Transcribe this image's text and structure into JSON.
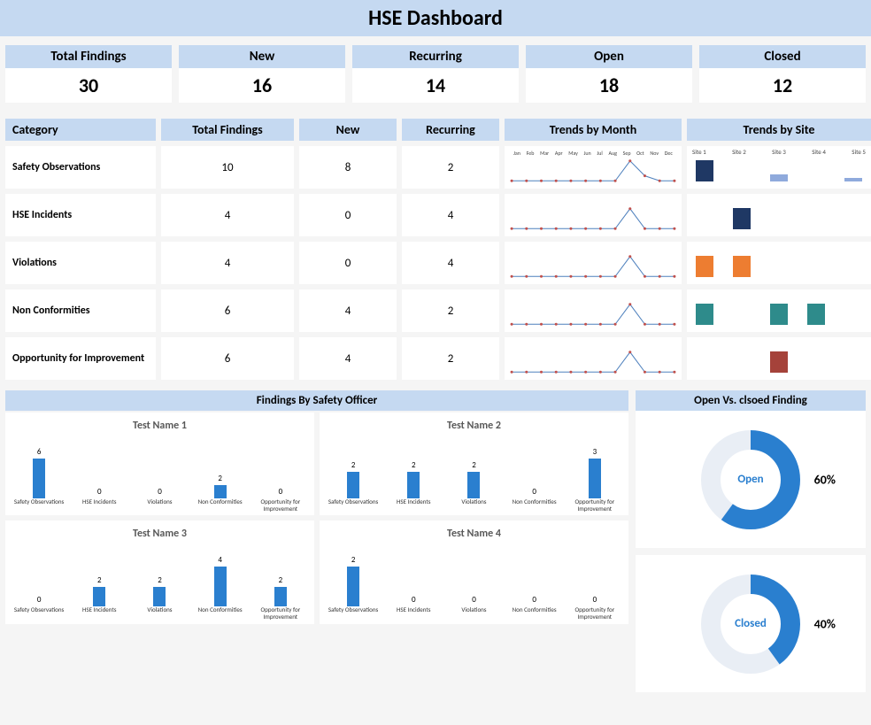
{
  "title": "HSE Dashboard",
  "kpis": [
    {
      "label": "Total Findings",
      "value": "30"
    },
    {
      "label": "New",
      "value": "16"
    },
    {
      "label": "Recurring",
      "value": "14"
    },
    {
      "label": "Open",
      "value": "18"
    },
    {
      "label": "Closed",
      "value": "12"
    }
  ],
  "cat_headers": {
    "category": "Category",
    "total": "Total Findings",
    "new": "New",
    "recurring": "Recurring",
    "trends_month": "Trends by Month",
    "trends_site": "Trends by Site"
  },
  "months": [
    "Jan",
    "Feb",
    "Mar",
    "Apr",
    "May",
    "Jun",
    "Jul",
    "Aug",
    "Sep",
    "Oct",
    "Nov",
    "Dec"
  ],
  "sites": [
    "Site 1",
    "Site 2",
    "Site 3",
    "Site 4",
    "Site 5"
  ],
  "categories": [
    {
      "name": "Safety Observations",
      "total": "10",
      "new": "8",
      "recurring": "2"
    },
    {
      "name": "HSE Incidents",
      "total": "4",
      "new": "0",
      "recurring": "4"
    },
    {
      "name": "Violations",
      "total": "4",
      "new": "0",
      "recurring": "4"
    },
    {
      "name": "Non Conformities",
      "total": "6",
      "new": "4",
      "recurring": "2"
    },
    {
      "name": "Opportunity for Improvement",
      "total": "6",
      "new": "4",
      "recurring": "2"
    }
  ],
  "officers_title": "Findings By Safety Officer",
  "officer_categories": [
    "Safety Observations",
    "HSE Incidents",
    "Violations",
    "Non Conformities",
    "Opportunity for Improvement"
  ],
  "officers": [
    {
      "name": "Test Name 1",
      "values": [
        6,
        0,
        0,
        2,
        0
      ]
    },
    {
      "name": "Test Name 2",
      "values": [
        2,
        2,
        2,
        0,
        3
      ]
    },
    {
      "name": "Test Name 3",
      "values": [
        0,
        2,
        2,
        4,
        2
      ]
    },
    {
      "name": "Test Name 4",
      "values": [
        2,
        0,
        0,
        0,
        0
      ]
    }
  ],
  "donuts_title": "Open Vs. clsoed Finding",
  "donuts": [
    {
      "label": "Open",
      "pct": "60%"
    },
    {
      "label": "Closed",
      "pct": "40%"
    }
  ],
  "chart_data": {
    "kpi_summary": {
      "Total Findings": 30,
      "New": 16,
      "Recurring": 14,
      "Open": 18,
      "Closed": 12
    },
    "category_table": [
      {
        "category": "Safety Observations",
        "total": 10,
        "new": 8,
        "recurring": 2
      },
      {
        "category": "HSE Incidents",
        "total": 4,
        "new": 0,
        "recurring": 4
      },
      {
        "category": "Violations",
        "total": 4,
        "new": 0,
        "recurring": 4
      },
      {
        "category": "Non Conformities",
        "total": 6,
        "new": 4,
        "recurring": 2
      },
      {
        "category": "Opportunity for Improvement",
        "total": 6,
        "new": 4,
        "recurring": 2
      }
    ],
    "trends_by_month": {
      "type": "line",
      "x": [
        "Jan",
        "Feb",
        "Mar",
        "Apr",
        "May",
        "Jun",
        "Jul",
        "Aug",
        "Sep",
        "Oct",
        "Nov",
        "Dec"
      ],
      "series": [
        {
          "name": "Safety Observations",
          "values": [
            0,
            0,
            0,
            0,
            0,
            0,
            0,
            0,
            8,
            2,
            0,
            0
          ]
        },
        {
          "name": "HSE Incidents",
          "values": [
            0,
            0,
            0,
            0,
            0,
            0,
            0,
            0,
            4,
            0,
            0,
            0
          ]
        },
        {
          "name": "Violations",
          "values": [
            0,
            0,
            0,
            0,
            0,
            0,
            0,
            0,
            4,
            0,
            0,
            0
          ]
        },
        {
          "name": "Non Conformities",
          "values": [
            0,
            0,
            0,
            0,
            0,
            0,
            0,
            0,
            6,
            0,
            0,
            0
          ]
        },
        {
          "name": "Opportunity for Improvement",
          "values": [
            0,
            0,
            0,
            0,
            0,
            0,
            0,
            0,
            6,
            0,
            0,
            0
          ]
        }
      ]
    },
    "trends_by_site": {
      "type": "bar",
      "categories": [
        "Site 1",
        "Site 2",
        "Site 3",
        "Site 4",
        "Site 5"
      ],
      "series": [
        {
          "name": "Safety Observations",
          "color": "#1f3864",
          "values": [
            6,
            0,
            2,
            0,
            1
          ]
        },
        {
          "name": "HSE Incidents",
          "color": "#1f3864",
          "values": [
            0,
            4,
            0,
            0,
            0
          ]
        },
        {
          "name": "Violations",
          "color": "#ed7d31",
          "values": [
            2,
            2,
            0,
            0,
            0
          ]
        },
        {
          "name": "Non Conformities",
          "color": "#2e8b8b",
          "values": [
            2,
            0,
            2,
            2,
            0
          ]
        },
        {
          "name": "Opportunity for Improvement",
          "color": "#a5423a",
          "values": [
            0,
            0,
            4,
            0,
            0
          ]
        }
      ]
    },
    "findings_by_officer": {
      "type": "bar",
      "categories": [
        "Safety Observations",
        "HSE Incidents",
        "Violations",
        "Non Conformities",
        "Opportunity for Improvement"
      ],
      "series": [
        {
          "name": "Test Name 1",
          "values": [
            6,
            0,
            0,
            2,
            0
          ]
        },
        {
          "name": "Test Name 2",
          "values": [
            2,
            2,
            2,
            0,
            3
          ]
        },
        {
          "name": "Test Name 3",
          "values": [
            0,
            2,
            2,
            4,
            2
          ]
        },
        {
          "name": "Test Name 4",
          "values": [
            2,
            0,
            0,
            0,
            0
          ]
        }
      ]
    },
    "open_vs_closed": {
      "type": "pie",
      "slices": [
        {
          "label": "Open",
          "value": 60
        },
        {
          "label": "Closed",
          "value": 40
        }
      ]
    }
  }
}
